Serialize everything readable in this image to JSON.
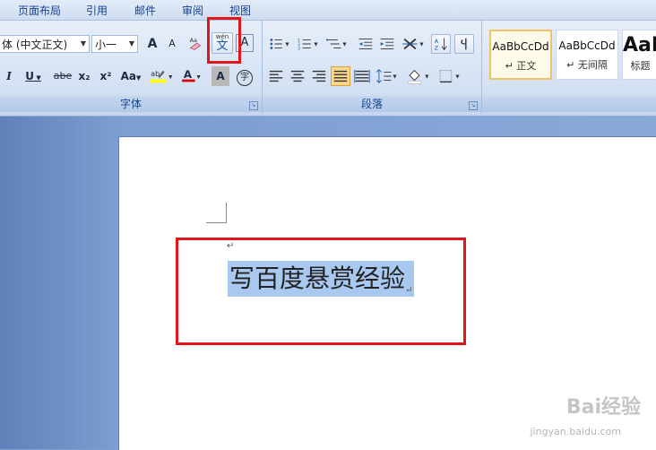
{
  "ribbon_tabs": [
    "页面布局",
    "引用",
    "邮件",
    "审阅",
    "视图"
  ],
  "font": {
    "font_name_value": "(中文正文)",
    "font_name_prefix": "体",
    "font_size_value": "小一",
    "group_label": "字体",
    "btn_italic": "I",
    "btn_underline": "U",
    "btn_strike": "abe",
    "btn_sub": "x₂",
    "btn_sup": "x²",
    "btn_case": "Aa",
    "btn_grow": "A",
    "btn_shrink": "A",
    "btn_phonetic": "文",
    "btn_phonetic_top": "wén",
    "btn_border": "A",
    "btn_shade": "A",
    "btn_enclose": "字",
    "highlight_color": "#ffff00",
    "font_color": "#e00000"
  },
  "paragraph": {
    "group_label": "段落"
  },
  "styles": {
    "items": [
      {
        "sample": "AaBbCcDd",
        "name": "↵ 正文"
      },
      {
        "sample": "AaBbCcDd",
        "name": "↵ 无间隔"
      },
      {
        "sample": "AaI",
        "name": "标题"
      }
    ]
  },
  "document": {
    "selected_text": "写百度悬赏经验",
    "paragraph_mark": "↵"
  },
  "watermark": {
    "brand": "Bai经验",
    "url": "jingyan.baidu.com"
  },
  "colors": {
    "highlight_red": "#e0161b",
    "selection": "#a8c8ef"
  }
}
